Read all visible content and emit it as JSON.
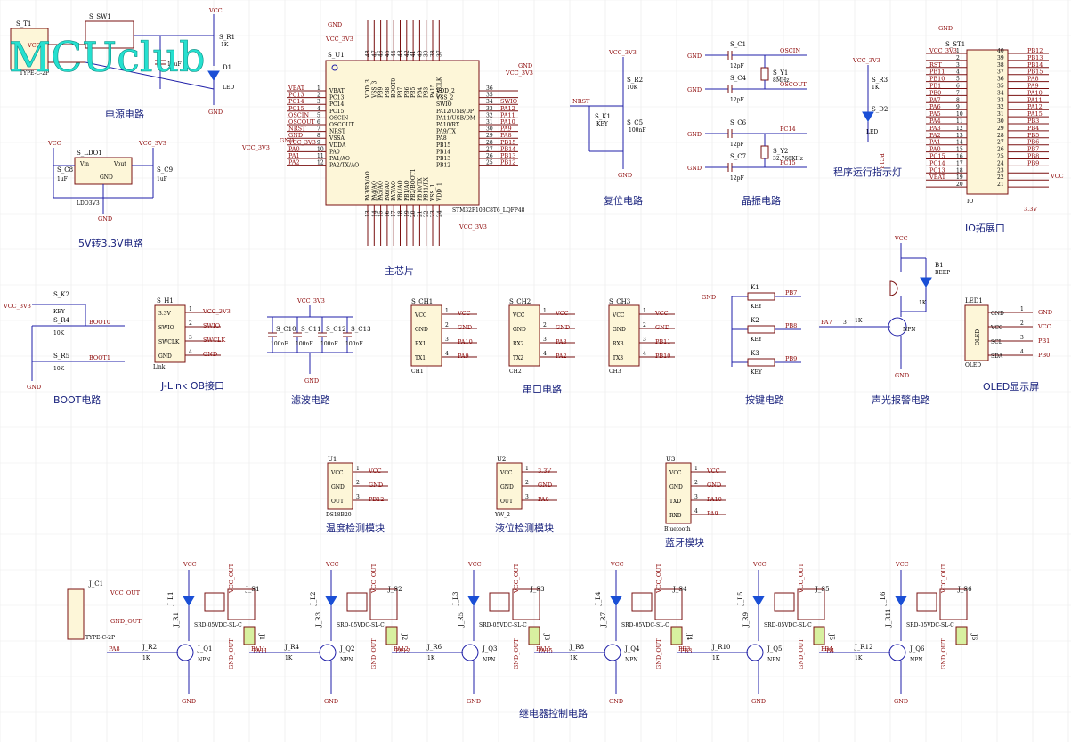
{
  "watermark": "MCUclub",
  "section_titles": {
    "power": "电源电路",
    "ldo": "5V转3.3V电路",
    "mcu": "主芯片",
    "reset": "复位电路",
    "crystal": "晶振电路",
    "run_led": "程序运行指示灯",
    "io": "IO拓展口",
    "boot": "BOOT电路",
    "jlink": "J-Link OB接口",
    "filter": "滤波电路",
    "uart": "串口电路",
    "keys": "按键电路",
    "alarm": "声光报警电路",
    "oled": "OLED显示屏",
    "temp": "温度检测模块",
    "level": "液位检测模块",
    "bt": "蓝牙模块",
    "relay": "继电器控制电路"
  },
  "power": {
    "t1": "S_T1",
    "t1_type": "TYPE-C-2P",
    "vcc": "VCC",
    "gnd": "GND",
    "sw": "S_SW1",
    "r1": "S_R1",
    "r1_val": "1K",
    "c_val": "10uF",
    "d1": "D1",
    "led": "LED"
  },
  "ldo": {
    "ref": "S_LDO1",
    "part": "LDO3V3",
    "vin": "Vin",
    "vout": "Vout",
    "gnd": "GND",
    "vcc": "VCC",
    "vcc33": "VCC_3V3",
    "c8": "S_C8",
    "c9": "S_C9",
    "cval": "1uF"
  },
  "mcu": {
    "ref": "S_U1",
    "part": "STM32F103C8T6_LQFP48",
    "gnd": "GND",
    "vcc33": "VCC_3V3",
    "left_pins": [
      {
        "n": "1",
        "name": "VBAT",
        "net": "VBAT"
      },
      {
        "n": "2",
        "name": "PC13",
        "net": "PC13"
      },
      {
        "n": "3",
        "name": "PC14",
        "net": "PC14"
      },
      {
        "n": "4",
        "name": "PC15",
        "net": "PC15"
      },
      {
        "n": "5",
        "name": "OSCIN",
        "net": "OSCIN"
      },
      {
        "n": "6",
        "name": "OSCOUT",
        "net": "OSCOUT"
      },
      {
        "n": "7",
        "name": "NRST",
        "net": "NRST"
      },
      {
        "n": "8",
        "name": "VSSA",
        "net": "GND"
      },
      {
        "n": "9",
        "name": "VDDA",
        "net": "VCC_3V3"
      },
      {
        "n": "10",
        "name": "PA0",
        "net": "PA0"
      },
      {
        "n": "11",
        "name": "PA1/AO",
        "net": "PA1"
      },
      {
        "n": "12",
        "name": "PA2/TX/AO",
        "net": "PA2"
      }
    ],
    "right_pins": [
      {
        "n": "36",
        "name": "VDD_2",
        "net": ""
      },
      {
        "n": "35",
        "name": "VSS_2",
        "net": ""
      },
      {
        "n": "34",
        "name": "SWIO",
        "net": "SWIO"
      },
      {
        "n": "33",
        "name": "PA12/USB/DP",
        "net": "PA12"
      },
      {
        "n": "32",
        "name": "PA11/USB/DM",
        "net": "PA11"
      },
      {
        "n": "31",
        "name": "PA10/RX",
        "net": "PA10"
      },
      {
        "n": "30",
        "name": "PA9/TX",
        "net": "PA9"
      },
      {
        "n": "29",
        "name": "PA8",
        "net": "PA8"
      },
      {
        "n": "28",
        "name": "PB15",
        "net": "PB15"
      },
      {
        "n": "27",
        "name": "PB14",
        "net": "PB14"
      },
      {
        "n": "26",
        "name": "PB13",
        "net": "PB13"
      },
      {
        "n": "25",
        "name": "PB12",
        "net": "PB12"
      }
    ],
    "top_pins": [
      "VDD_3",
      "VSS_3",
      "PB9",
      "PB8",
      "BOOT0",
      "PB7",
      "PB6",
      "PB5",
      "PB4",
      "PB3",
      "PA15",
      "SWCLK"
    ],
    "top_nums": [
      "48",
      "47",
      "46",
      "45",
      "44",
      "43",
      "42",
      "41",
      "40",
      "39",
      "38",
      "37"
    ],
    "bottom_pins": [
      "PA3/RX/AO",
      "PA4/AO",
      "PA5/AO",
      "PA6/AO",
      "PA7/AO",
      "PB0/AO",
      "PB1/AO",
      "PB2/BOOT1",
      "PB10/TX",
      "PB11/RX",
      "VSS_1",
      "VDD_1"
    ],
    "bottom_nums": [
      "13",
      "14",
      "15",
      "16",
      "17",
      "18",
      "19",
      "20",
      "21",
      "22",
      "23",
      "24"
    ]
  },
  "reset": {
    "vcc33": "VCC_3V3",
    "r2": "S_R2",
    "r2_val": "10K",
    "nrst": "NRST",
    "k1": "S_K1",
    "key": "KEY",
    "c5": "S_C5",
    "c5_val": "100nF",
    "gnd": "GND"
  },
  "crystal": {
    "c1": "S_C1",
    "c4": "S_C4",
    "c6": "S_C6",
    "c7": "S_C7",
    "cval": "12pF",
    "y1": "S_Y1",
    "y1_val": "8MHz",
    "y2": "S_Y2",
    "y2_val": "32.768KHz",
    "oscin": "OSCIN",
    "oscout": "OSCOUT",
    "pc14": "PC14",
    "pc15": "PC15",
    "gnd": "GND"
  },
  "run_led": {
    "vcc33": "VCC_3V3",
    "r3": "S_R3",
    "r3_val": "1K",
    "d2": "S_D2",
    "led": "LED",
    "net": "PC13"
  },
  "io": {
    "ref": "S_ST1",
    "label": "IO",
    "gnd": "GND",
    "vcc33": "VCC_3V3",
    "vcc": "VCC",
    "v33": "3.3V",
    "left": [
      "VCC_3V3",
      "",
      "RST",
      "PB11",
      "PB10",
      "PB1",
      "PB0",
      "PA7",
      "PA6",
      "PA5",
      "PA4",
      "PA3",
      "PA2",
      "PA1",
      "PA0",
      "PC15",
      "PC14",
      "PC13",
      "VBAT"
    ],
    "left_nums": [
      "1",
      "2",
      "3",
      "4",
      "5",
      "6",
      "7",
      "8",
      "9",
      "10",
      "11",
      "12",
      "13",
      "14",
      "15",
      "16",
      "17",
      "18",
      "19",
      "20"
    ],
    "right": [
      "PB12",
      "PB13",
      "PB14",
      "PB15",
      "PA8",
      "PA9",
      "PA10",
      "PA11",
      "PA12",
      "PA15",
      "PB3",
      "PB4",
      "PB5",
      "PB6",
      "PB7",
      "PB8",
      "PB9",
      "",
      "",
      ""
    ],
    "right_nums": [
      "40",
      "39",
      "38",
      "37",
      "36",
      "35",
      "34",
      "33",
      "32",
      "31",
      "30",
      "29",
      "28",
      "27",
      "26",
      "25",
      "24",
      "23",
      "22",
      "21"
    ]
  },
  "boot": {
    "vcc33": "VCC_3V3",
    "k2": "S_K2",
    "key": "KEY",
    "r4": "S_R4",
    "r5": "S_R5",
    "rval": "10K",
    "boot0": "BOOT0",
    "boot1": "BOOT1",
    "gnd": "GND"
  },
  "jlink": {
    "ref": "S_H1",
    "name": "Link",
    "pins": [
      "3.3V",
      "SWIO",
      "SWCLK",
      "GND"
    ],
    "nets": [
      "VCC_3V3",
      "SWIO",
      "SWCLK",
      "GND"
    ]
  },
  "filter": {
    "vcc33": "VCC_3V3",
    "caps": [
      "S_C10",
      "S_C11",
      "S_C12",
      "S_C13"
    ],
    "cval": "100nF",
    "gnd": "GND"
  },
  "uart": {
    "modules": [
      {
        "ref": "S_CH1",
        "name": "CH1",
        "pins": [
          "VCC",
          "GND",
          "RX1",
          "TX1"
        ],
        "nets": [
          "VCC",
          "GND",
          "PA10",
          "PA9"
        ]
      },
      {
        "ref": "S_CH2",
        "name": "CH2",
        "pins": [
          "VCC",
          "GND",
          "RX2",
          "TX2"
        ],
        "nets": [
          "VCC",
          "GND",
          "PA3",
          "PA2"
        ]
      },
      {
        "ref": "S_CH3",
        "name": "CH3",
        "pins": [
          "VCC",
          "GND",
          "RX3",
          "TX3"
        ],
        "nets": [
          "VCC",
          "GND",
          "PB11",
          "PB10"
        ]
      }
    ]
  },
  "keys": {
    "gnd": "GND",
    "items": [
      {
        "ref": "K1",
        "label": "KEY",
        "net": "PB7"
      },
      {
        "ref": "K2",
        "label": "KEY",
        "net": "PB8"
      },
      {
        "ref": "K3",
        "label": "KEY",
        "net": "PB9"
      }
    ]
  },
  "alarm": {
    "vcc": "VCC",
    "b1": "B1",
    "beep": "BEEP",
    "r": "1K",
    "rin": "1K",
    "net": "PA7",
    "npn": "NPN",
    "gnd": "GND",
    "pin": "3"
  },
  "oled": {
    "ref": "LED1",
    "name": "OLED",
    "pins": [
      "GND",
      "VCC",
      "SCL",
      "SDA"
    ],
    "nets": [
      "GND",
      "VCC",
      "PB1",
      "PB0"
    ]
  },
  "temp": {
    "ref": "U1",
    "name": "DS18B20",
    "pins": [
      "VCC",
      "GND",
      "OUT"
    ],
    "nets": [
      "VCC",
      "GND",
      "PB12"
    ]
  },
  "level": {
    "ref": "U2",
    "name": "YW_2",
    "pins": [
      "VCC",
      "GND",
      "OUT"
    ],
    "nets": [
      "3.3V",
      "GND",
      "PA0"
    ]
  },
  "bt": {
    "ref": "U3",
    "name": "Bluetooth",
    "pins": [
      "VCC",
      "GND",
      "TXD",
      "RXD"
    ],
    "nets": [
      "VCC",
      "GND",
      "PA10",
      "PA9"
    ]
  },
  "relay": {
    "conn": "J_C1",
    "conn_type": "TYPE-C-2P",
    "vcc_out": "VCC_OUT",
    "gnd_out": "GND_OUT",
    "vcc": "VCC",
    "gnd": "GND",
    "npn": "NPN",
    "relay_part": "SRD-05VDC-SL-C",
    "rval": "1K",
    "channels": [
      {
        "led": "J_L1",
        "rled": "J_R1",
        "sw": "J_S1",
        "q": "J_Q1",
        "rin": "J_R2",
        "net": "PA8",
        "out": "PA11",
        "j": "J1"
      },
      {
        "led": "J_L2",
        "rled": "J_R3",
        "sw": "J_S2",
        "q": "J_Q2",
        "rin": "J_R4",
        "net": "PA11",
        "out": "PA12",
        "j": "J2"
      },
      {
        "led": "J_L3",
        "rled": "J_R5",
        "sw": "J_S3",
        "q": "J_Q3",
        "rin": "J_R6",
        "net": "PA12",
        "out": "PA15",
        "j": "J3"
      },
      {
        "led": "J_L4",
        "rled": "J_R7",
        "sw": "J_S4",
        "q": "J_Q4",
        "rin": "J_R8",
        "net": "PA15",
        "out": "PB3",
        "j": "J4"
      },
      {
        "led": "J_L5",
        "rled": "J_R9",
        "sw": "J_S5",
        "q": "J_Q5",
        "rin": "J_R10",
        "net": "PB3",
        "out": "PB4",
        "j": "J5"
      },
      {
        "led": "J_L6",
        "rled": "J_R11",
        "sw": "J_S6",
        "q": "J_Q6",
        "rin": "J_R12",
        "net": "PB4",
        "out": "",
        "j": "J6"
      }
    ]
  }
}
